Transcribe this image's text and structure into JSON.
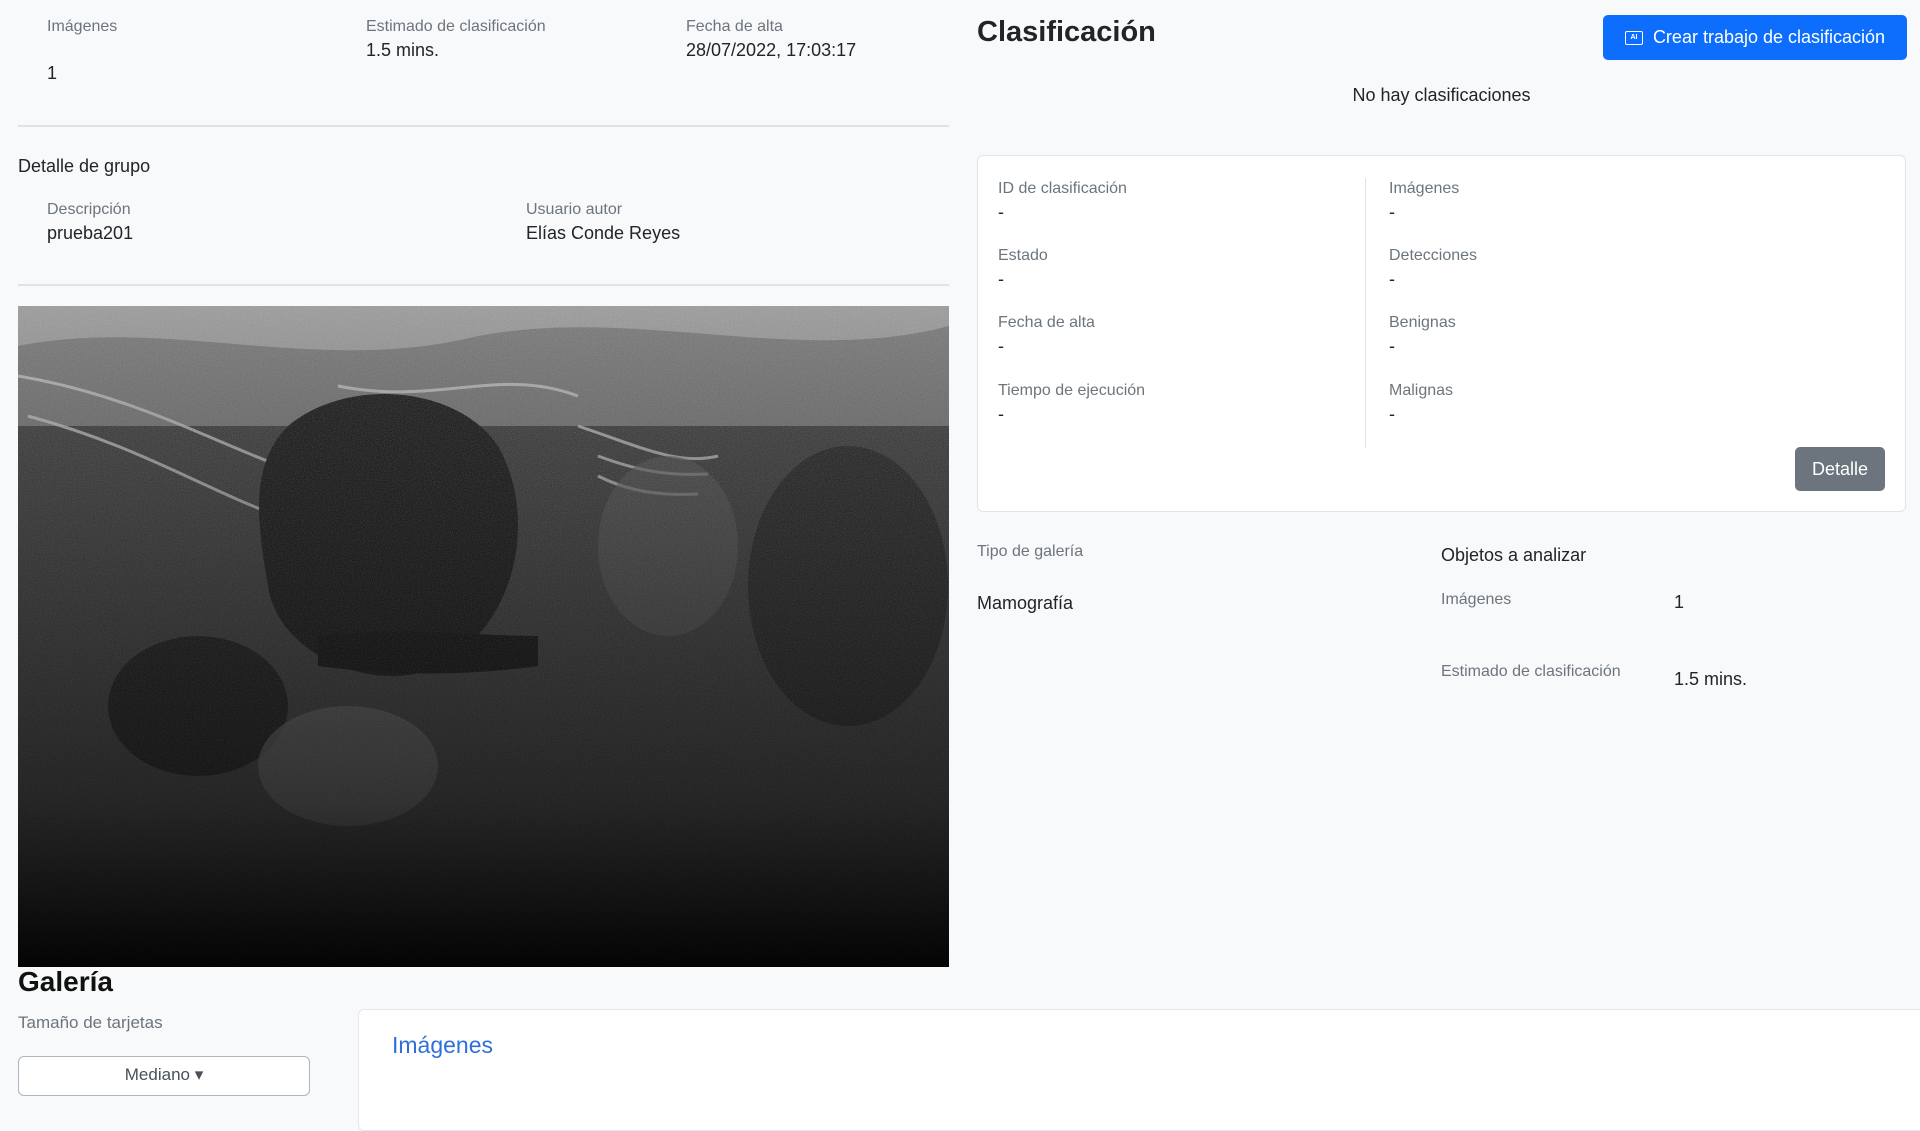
{
  "top_meta": {
    "images_label": "Imágenes",
    "images_value": "1",
    "estimate_label": "Estimado de clasificación",
    "estimate_value": "1.5 mins.",
    "date_label": "Fecha de alta",
    "date_value": "28/07/2022, 17:03:17"
  },
  "group_detail": {
    "title": "Detalle de grupo",
    "description_label": "Descripción",
    "description_value": "prueba201",
    "author_label": "Usuario autor",
    "author_value": "Elías Conde Reyes"
  },
  "gallery": {
    "title": "Galería",
    "card_size_label": "Tamaño de tarjetas",
    "card_size_value": "Mediano ▾",
    "images_panel_title": "Imágenes"
  },
  "classification": {
    "title": "Clasificación",
    "create_button_label": "Crear trabajo de clasificación",
    "empty_message": "No hay clasificaciones",
    "card": {
      "id_label": "ID de clasificación",
      "id_value": "-",
      "state_label": "Estado",
      "state_value": "-",
      "date_label": "Fecha de alta",
      "date_value": "-",
      "exec_label": "Tiempo de ejecución",
      "exec_value": "-",
      "images_label": "Imágenes",
      "images_value": "-",
      "detections_label": "Detecciones",
      "detections_value": "-",
      "benign_label": "Benignas",
      "benign_value": "-",
      "malign_label": "Malignas",
      "malign_value": "-",
      "detail_button_label": "Detalle"
    }
  },
  "gallery_info": {
    "type_label": "Tipo de galería",
    "type_value": "Mamografía",
    "objects_title": "Objetos a analizar",
    "images_label": "Imágenes",
    "images_value": "1",
    "estimate_label": "Estimado de clasificación",
    "estimate_value": "1.5 mins."
  },
  "colors": {
    "primary": "#0d6efd",
    "secondary": "#6c757d",
    "link": "#2f6fdc"
  }
}
